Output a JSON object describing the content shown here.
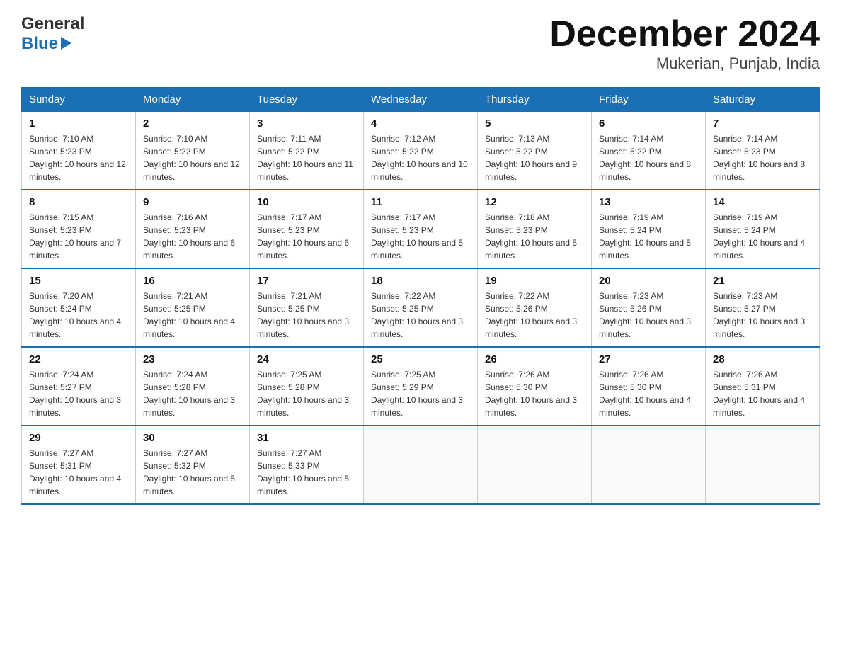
{
  "logo": {
    "text_general": "General",
    "text_blue": "Blue",
    "arrow": "▶"
  },
  "title": "December 2024",
  "location": "Mukerian, Punjab, India",
  "days_of_week": [
    "Sunday",
    "Monday",
    "Tuesday",
    "Wednesday",
    "Thursday",
    "Friday",
    "Saturday"
  ],
  "weeks": [
    [
      {
        "day": "1",
        "sunrise": "7:10 AM",
        "sunset": "5:23 PM",
        "daylight": "10 hours and 12 minutes."
      },
      {
        "day": "2",
        "sunrise": "7:10 AM",
        "sunset": "5:22 PM",
        "daylight": "10 hours and 12 minutes."
      },
      {
        "day": "3",
        "sunrise": "7:11 AM",
        "sunset": "5:22 PM",
        "daylight": "10 hours and 11 minutes."
      },
      {
        "day": "4",
        "sunrise": "7:12 AM",
        "sunset": "5:22 PM",
        "daylight": "10 hours and 10 minutes."
      },
      {
        "day": "5",
        "sunrise": "7:13 AM",
        "sunset": "5:22 PM",
        "daylight": "10 hours and 9 minutes."
      },
      {
        "day": "6",
        "sunrise": "7:14 AM",
        "sunset": "5:22 PM",
        "daylight": "10 hours and 8 minutes."
      },
      {
        "day": "7",
        "sunrise": "7:14 AM",
        "sunset": "5:23 PM",
        "daylight": "10 hours and 8 minutes."
      }
    ],
    [
      {
        "day": "8",
        "sunrise": "7:15 AM",
        "sunset": "5:23 PM",
        "daylight": "10 hours and 7 minutes."
      },
      {
        "day": "9",
        "sunrise": "7:16 AM",
        "sunset": "5:23 PM",
        "daylight": "10 hours and 6 minutes."
      },
      {
        "day": "10",
        "sunrise": "7:17 AM",
        "sunset": "5:23 PM",
        "daylight": "10 hours and 6 minutes."
      },
      {
        "day": "11",
        "sunrise": "7:17 AM",
        "sunset": "5:23 PM",
        "daylight": "10 hours and 5 minutes."
      },
      {
        "day": "12",
        "sunrise": "7:18 AM",
        "sunset": "5:23 PM",
        "daylight": "10 hours and 5 minutes."
      },
      {
        "day": "13",
        "sunrise": "7:19 AM",
        "sunset": "5:24 PM",
        "daylight": "10 hours and 5 minutes."
      },
      {
        "day": "14",
        "sunrise": "7:19 AM",
        "sunset": "5:24 PM",
        "daylight": "10 hours and 4 minutes."
      }
    ],
    [
      {
        "day": "15",
        "sunrise": "7:20 AM",
        "sunset": "5:24 PM",
        "daylight": "10 hours and 4 minutes."
      },
      {
        "day": "16",
        "sunrise": "7:21 AM",
        "sunset": "5:25 PM",
        "daylight": "10 hours and 4 minutes."
      },
      {
        "day": "17",
        "sunrise": "7:21 AM",
        "sunset": "5:25 PM",
        "daylight": "10 hours and 3 minutes."
      },
      {
        "day": "18",
        "sunrise": "7:22 AM",
        "sunset": "5:25 PM",
        "daylight": "10 hours and 3 minutes."
      },
      {
        "day": "19",
        "sunrise": "7:22 AM",
        "sunset": "5:26 PM",
        "daylight": "10 hours and 3 minutes."
      },
      {
        "day": "20",
        "sunrise": "7:23 AM",
        "sunset": "5:26 PM",
        "daylight": "10 hours and 3 minutes."
      },
      {
        "day": "21",
        "sunrise": "7:23 AM",
        "sunset": "5:27 PM",
        "daylight": "10 hours and 3 minutes."
      }
    ],
    [
      {
        "day": "22",
        "sunrise": "7:24 AM",
        "sunset": "5:27 PM",
        "daylight": "10 hours and 3 minutes."
      },
      {
        "day": "23",
        "sunrise": "7:24 AM",
        "sunset": "5:28 PM",
        "daylight": "10 hours and 3 minutes."
      },
      {
        "day": "24",
        "sunrise": "7:25 AM",
        "sunset": "5:28 PM",
        "daylight": "10 hours and 3 minutes."
      },
      {
        "day": "25",
        "sunrise": "7:25 AM",
        "sunset": "5:29 PM",
        "daylight": "10 hours and 3 minutes."
      },
      {
        "day": "26",
        "sunrise": "7:26 AM",
        "sunset": "5:30 PM",
        "daylight": "10 hours and 3 minutes."
      },
      {
        "day": "27",
        "sunrise": "7:26 AM",
        "sunset": "5:30 PM",
        "daylight": "10 hours and 4 minutes."
      },
      {
        "day": "28",
        "sunrise": "7:26 AM",
        "sunset": "5:31 PM",
        "daylight": "10 hours and 4 minutes."
      }
    ],
    [
      {
        "day": "29",
        "sunrise": "7:27 AM",
        "sunset": "5:31 PM",
        "daylight": "10 hours and 4 minutes."
      },
      {
        "day": "30",
        "sunrise": "7:27 AM",
        "sunset": "5:32 PM",
        "daylight": "10 hours and 5 minutes."
      },
      {
        "day": "31",
        "sunrise": "7:27 AM",
        "sunset": "5:33 PM",
        "daylight": "10 hours and 5 minutes."
      },
      null,
      null,
      null,
      null
    ]
  ]
}
